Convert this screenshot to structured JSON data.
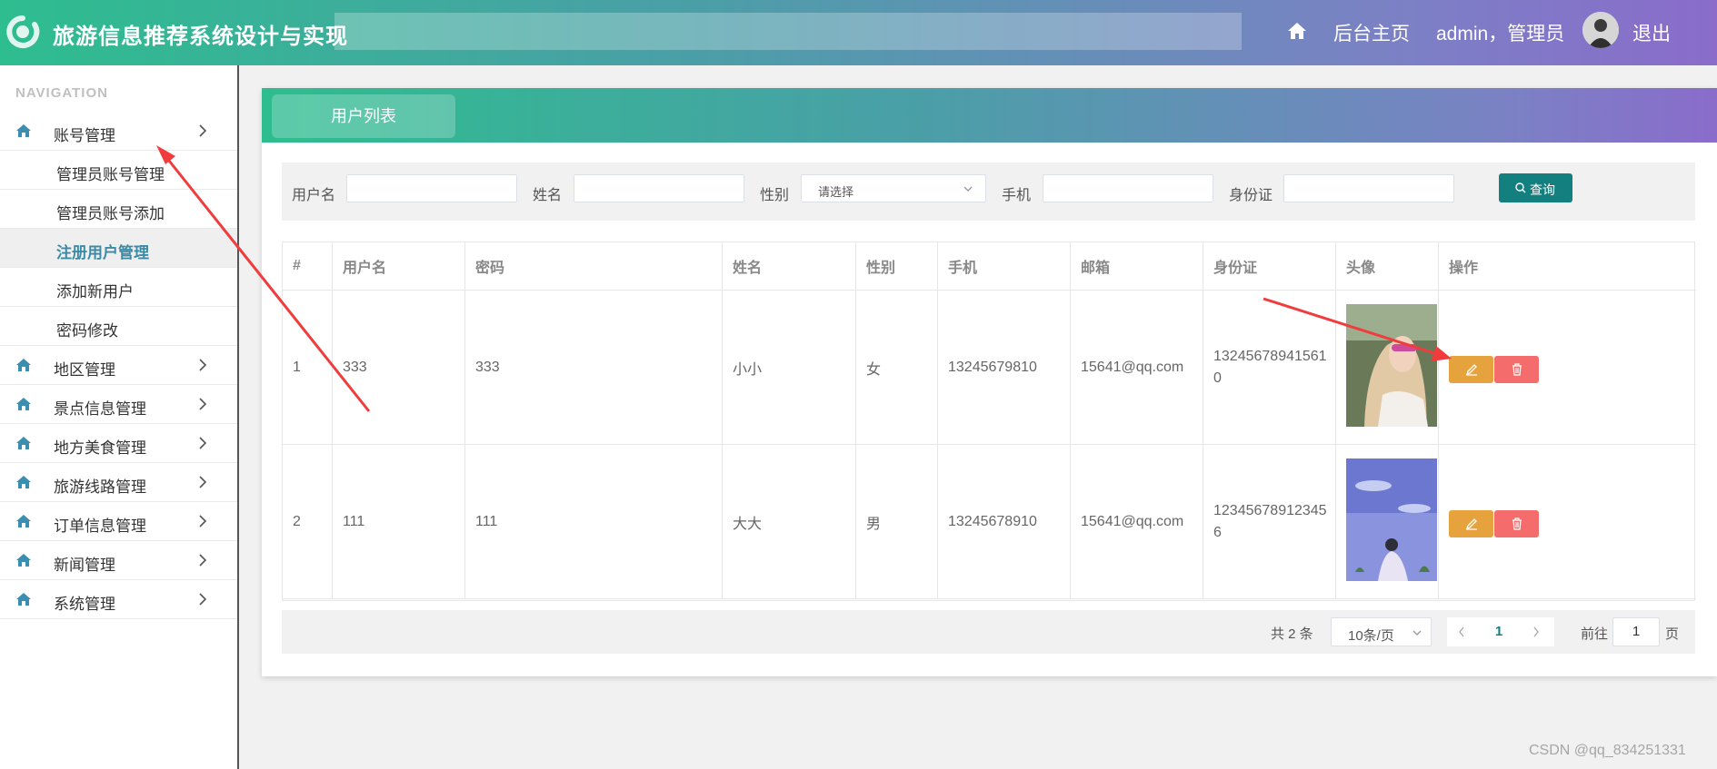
{
  "header": {
    "title": "旅游信息推荐系统设计与实现",
    "home_link": "后台主页",
    "user_label": "admin，管理员",
    "logout": "退出"
  },
  "sidebar": {
    "heading": "NAVIGATION",
    "groups": [
      {
        "label": "账号管理",
        "children": [
          "管理员账号管理",
          "管理员账号添加",
          "注册用户管理",
          "添加新用户",
          "密码修改"
        ]
      },
      {
        "label": "地区管理"
      },
      {
        "label": "景点信息管理"
      },
      {
        "label": "地方美食管理"
      },
      {
        "label": "旅游线路管理"
      },
      {
        "label": "订单信息管理"
      },
      {
        "label": "新闻管理"
      },
      {
        "label": "系统管理"
      }
    ],
    "active_item": "注册用户管理"
  },
  "panel": {
    "tab": "用户列表"
  },
  "search": {
    "username_label": "用户名",
    "name_label": "姓名",
    "gender_label": "性别",
    "gender_value": "请选择",
    "phone_label": "手机",
    "idcard_label": "身份证",
    "query_button": "查询"
  },
  "table": {
    "columns": [
      "#",
      "用户名",
      "密码",
      "姓名",
      "性别",
      "手机",
      "邮箱",
      "身份证",
      "头像",
      "操作"
    ],
    "rows": [
      [
        "1",
        "333",
        "333",
        "小小",
        "女",
        "13245679810",
        "15641@qq.com",
        "132456789415610"
      ],
      [
        "2",
        "111",
        "111",
        "大大",
        "男",
        "13245678910",
        "15641@qq.com",
        "123456789123456"
      ]
    ]
  },
  "pagination": {
    "total": "共 2 条",
    "page_size": "10条/页",
    "current_page": "1",
    "goto_label": "前往",
    "goto_value": "1",
    "goto_suffix": "页"
  },
  "watermark": "CSDN @qq_834251331",
  "colors": {
    "header_gradient_start": "#2ebd8f",
    "header_gradient_end": "#8a6ccb",
    "primary_button": "#137f7f",
    "edit_button": "#e6a23c",
    "delete_button": "#f56c6c",
    "active_menu_text": "#3d8aa6",
    "annotation_arrow": "#f03c3c"
  }
}
